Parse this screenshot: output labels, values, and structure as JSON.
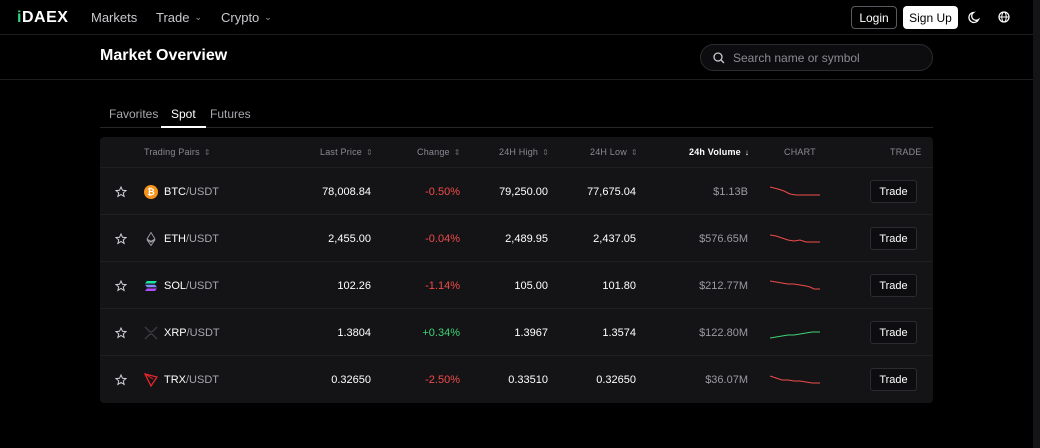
{
  "nav": {
    "logo": "DAEX",
    "markets": "Markets",
    "trade": "Trade",
    "crypto": "Crypto",
    "login": "Login",
    "signup": "Sign Up"
  },
  "header": {
    "title": "Market Overview",
    "search_placeholder": "Search name or symbol"
  },
  "tabs": [
    "Favorites",
    "Spot",
    "Futures"
  ],
  "columns": {
    "pairs": "Trading Pairs",
    "last_price": "Last Price",
    "change": "Change",
    "high": "24H High",
    "low": "24H Low",
    "volume": "24h Volume",
    "chart": "CHART",
    "trade": "TRADE"
  },
  "rows": [
    {
      "base": "BTC",
      "quote": "/USDT",
      "price": "78,008.84",
      "change": "-0.50%",
      "high": "79,250.00",
      "low": "77,675.04",
      "volume": "$1.13B",
      "trade": "Trade",
      "trend": "down",
      "color": "#f7931a"
    },
    {
      "base": "ETH",
      "quote": "/USDT",
      "price": "2,455.00",
      "change": "-0.04%",
      "high": "2,489.95",
      "low": "2,437.05",
      "volume": "$576.65M",
      "trade": "Trade",
      "trend": "down",
      "color": "#8a8a92"
    },
    {
      "base": "SOL",
      "quote": "/USDT",
      "price": "102.26",
      "change": "-1.14%",
      "high": "105.00",
      "low": "101.80",
      "volume": "$212.77M",
      "trade": "Trade",
      "trend": "down",
      "color": "#9b59ff"
    },
    {
      "base": "XRP",
      "quote": "/USDT",
      "price": "1.3804",
      "change": "+0.34%",
      "high": "1.3967",
      "low": "1.3574",
      "volume": "$122.80M",
      "trade": "Trade",
      "trend": "up",
      "color": "#2a2a2e"
    },
    {
      "base": "TRX",
      "quote": "/USDT",
      "price": "0.32650",
      "change": "-2.50%",
      "high": "0.33510",
      "low": "0.32650",
      "volume": "$36.07M",
      "trade": "Trade",
      "trend": "down",
      "color": "#e8262b"
    }
  ],
  "colors": {
    "negative": "#f04b4b",
    "positive": "#3fd377",
    "accent": "#33d17a"
  }
}
